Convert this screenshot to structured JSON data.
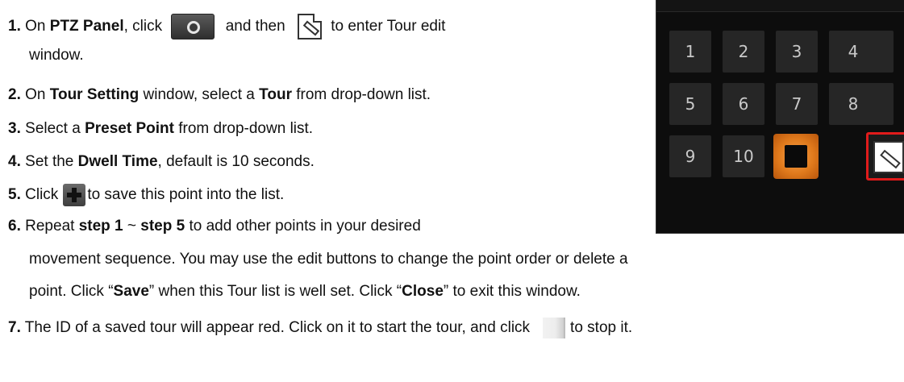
{
  "steps": [
    {
      "num": "1.",
      "parts": [
        "On ",
        "PTZ Panel",
        ", click",
        "and then",
        "to enter Tour edit"
      ],
      "cont": "window."
    },
    {
      "num": "2.",
      "parts": [
        "On ",
        "Tour Setting",
        " window, select a ",
        "Tour",
        " from drop-down list."
      ]
    },
    {
      "num": "3.",
      "parts": [
        "Select a ",
        "Preset Point",
        " from drop-down list."
      ]
    },
    {
      "num": "4.",
      "parts": [
        "Set the ",
        "Dwell Time",
        ", default is 10 seconds."
      ]
    },
    {
      "num": "5.",
      "parts": [
        "Click",
        "to save this point into the list."
      ]
    },
    {
      "num": "6.",
      "parts": [
        "Repeat ",
        "step 1",
        " ~ ",
        "step 5",
        " to add other points in your desired"
      ],
      "cont": "movement sequence. You may use the edit buttons to change the point order or delete a",
      "cont2": [
        "point. Click “",
        "Save",
        "” when this Tour list is well set. Click “",
        "Close",
        "” to exit this window."
      ]
    },
    {
      "num": "7.",
      "parts": [
        "The ID of a saved tour will appear red. Click on it to start the tour, and click",
        "to stop it."
      ]
    }
  ],
  "ptz": {
    "buttons": [
      "1",
      "2",
      "3",
      "4",
      "5",
      "6",
      "7",
      "8",
      "9",
      "10"
    ]
  },
  "icons": {
    "gear": "gear-icon",
    "edit": "edit-icon",
    "add": "add-icon",
    "stop": "stop-icon"
  }
}
